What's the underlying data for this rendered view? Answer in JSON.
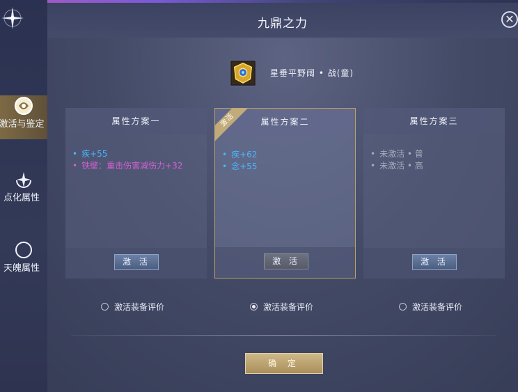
{
  "window": {
    "title": "九鼎之力",
    "close_glyph": "✕"
  },
  "sidebar": {
    "items": [
      {
        "label": "激活与鉴定",
        "icon": "activation-emblem-icon",
        "active": true
      },
      {
        "label": "点化属性",
        "icon": "sparkle-refine-icon",
        "active": false
      },
      {
        "label": "天魄属性",
        "icon": "crescent-soul-icon",
        "active": false
      }
    ]
  },
  "equipment": {
    "name": "星垂平野阔 • 战(童)",
    "icon": "golden-armor-icon"
  },
  "schemes": [
    {
      "title": "属性方案一",
      "attributes": [
        {
          "dot": "•",
          "text": "疾+55",
          "color": "#49b6ff"
        },
        {
          "dot": "•",
          "text": "铁壁：重击伤害减伤力+32",
          "color": "#d45fd0"
        }
      ],
      "button": "激 活",
      "radio_label": "激活装备评价",
      "radio_checked": false
    },
    {
      "title": "属性方案二",
      "badge": "激活",
      "attributes": [
        {
          "dot": "•",
          "text": "疾+62",
          "color": "#49b6ff"
        },
        {
          "dot": "•",
          "text": "念+55",
          "color": "#49b6ff"
        }
      ],
      "button": "激 活",
      "radio_label": "激活装备评价",
      "radio_checked": true
    },
    {
      "title": "属性方案三",
      "attributes": [
        {
          "dot": "•",
          "text": "未激活 • 普",
          "color": "#a6abbb"
        },
        {
          "dot": "•",
          "text": "未激活 • 高",
          "color": "#a6abbb"
        }
      ],
      "button": "激 活",
      "radio_label": "激活装备评价",
      "radio_checked": false
    }
  ],
  "footer": {
    "confirm_label": "确 定"
  },
  "colors": {
    "accent_gold": "#c2ab7b",
    "attr_blue": "#49b6ff",
    "attr_pink": "#d45fd0",
    "inactive_gray": "#a6abbb"
  }
}
